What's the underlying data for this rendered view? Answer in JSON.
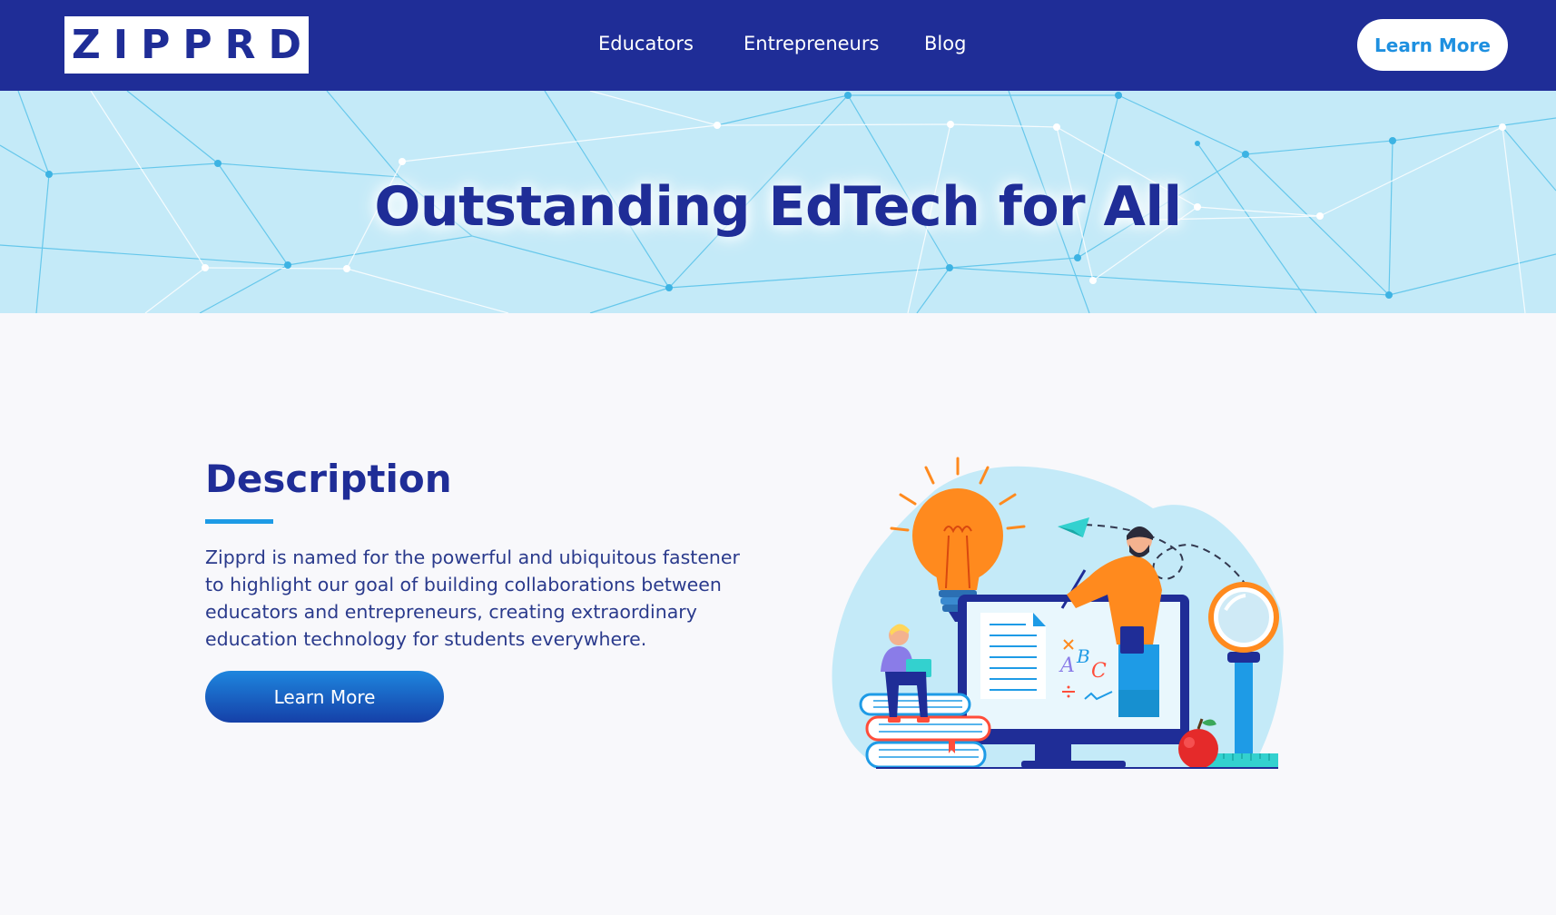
{
  "nav": {
    "logo_text": "ZIPPRD",
    "links": [
      "Educators",
      "Entrepreneurs",
      "Blog"
    ],
    "cta_label": "Learn More"
  },
  "hero": {
    "title": "Outstanding EdTech for All"
  },
  "description": {
    "heading": "Description",
    "text": "Zipprd is named for the powerful and ubiquitous fastener to highlight our goal of building collaborations between educators and entrepreneurs, creating extraordinary education technology for students everywhere.",
    "button_label": "Learn More"
  },
  "illustration": {
    "letters": [
      "A",
      "B",
      "C"
    ]
  },
  "colors": {
    "navy": "#1f2d97",
    "accent_blue": "#1e90e0",
    "hero_bg": "#c4eaf8",
    "page_bg": "#f8f8fb",
    "orange": "#ff8a1e"
  }
}
